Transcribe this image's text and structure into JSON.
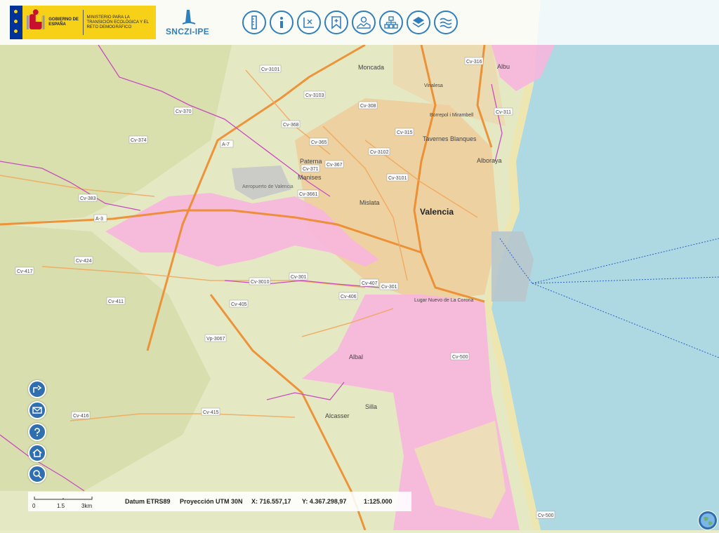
{
  "header": {
    "gov_label": "GOBIERNO DE ESPAÑA",
    "ministry_label": "MINISTERIO PARA LA TRANSICIÓN ECOLÓGICA Y EL RETO DEMOGRÁFICO",
    "app_name": "SNCZI-IPE"
  },
  "toolbar": [
    {
      "name": "legend-tool",
      "icon": "ruler-icon"
    },
    {
      "name": "info-tool",
      "icon": "info-icon"
    },
    {
      "name": "coordinates-tool",
      "icon": "coordinates-icon"
    },
    {
      "name": "bookmark-tool",
      "icon": "bookmark-icon"
    },
    {
      "name": "map-tool",
      "icon": "map-pin-icon"
    },
    {
      "name": "tree-tool",
      "icon": "hierarchy-icon"
    },
    {
      "name": "layers-tool",
      "icon": "layers-icon"
    },
    {
      "name": "flood-tool",
      "icon": "waves-icon"
    }
  ],
  "sidebar": [
    {
      "name": "share-button",
      "icon": "share-icon"
    },
    {
      "name": "email-button",
      "icon": "envelope-icon"
    },
    {
      "name": "help-button",
      "icon": "question-icon"
    },
    {
      "name": "home-button",
      "icon": "home-icon"
    },
    {
      "name": "zoom-button",
      "icon": "zoom-icon"
    }
  ],
  "status": {
    "scale_0": "0",
    "scale_1": "1.5",
    "scale_2": "3km",
    "datum": "Datum ETRS89",
    "projection": "Proyección UTM 30N",
    "x": "X: 716.557,17",
    "y": "Y: 4.367.298,97",
    "ratio": "1:125.000"
  },
  "places": {
    "valencia": "Valencia",
    "moncada": "Moncada",
    "vinalesa": "Vinalesa",
    "borrepol": "Borrepol i Mirambell",
    "tavernes": "Tavernes Blanques",
    "alboraya": "Alboraya",
    "albuixech": "Albu",
    "paterna": "Paterna",
    "manises": "Manises",
    "aeropuerto": "Aeropuerto de Valencia",
    "mislata": "Mislata",
    "albal": "Albal",
    "silla": "Silla",
    "alcasser": "Alcasser",
    "lugar_nuevo": "Lugar Nuevo de La Corona"
  },
  "roads": {
    "cv3101a": "Cv-3101",
    "cv3103": "Cv-3103",
    "cv308": "Cv-308",
    "cv316": "Cv-316",
    "cv370": "Cv-370",
    "cv368": "Cv-368",
    "cv315": "Cv-315",
    "cv311": "Cv-311",
    "cv374": "Cv-374",
    "a7": "A-7",
    "cv365": "Cv-365",
    "cv3102": "Cv-3102",
    "cv371": "Cv-371",
    "cv367": "Cv-367",
    "cv3101b": "Cv-3101",
    "cv3661": "Cv-3661",
    "cv383": "Cv-383",
    "a3": "A-3",
    "cv424": "Cv-424",
    "cv417": "Cv-417",
    "cv3010": "Cv-3010",
    "cv3014": "Cv-301",
    "cv407": "Cv-407",
    "cv301": "Cv-301",
    "cv411": "Cv-411",
    "cv405": "Cv-405",
    "cv406": "Cv-406",
    "vp3067": "Vp-3067",
    "cv500": "Cv-500",
    "cv415": "Cv-415",
    "cv416": "Cv-416",
    "cv500b": "Cv-500"
  }
}
